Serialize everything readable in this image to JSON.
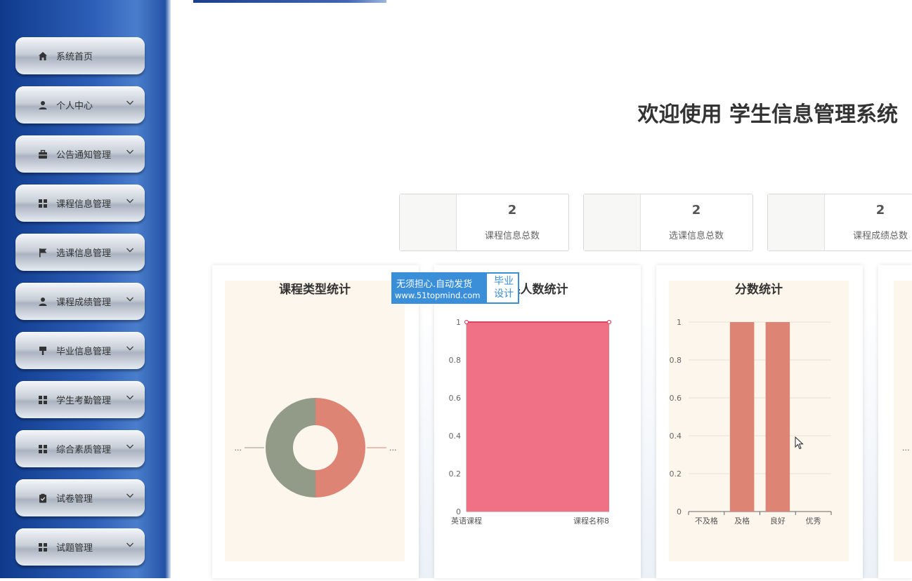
{
  "sidebar": {
    "items": [
      {
        "label": "系统首页",
        "icon": "home-icon",
        "has_children": false
      },
      {
        "label": "个人中心",
        "icon": "user-icon",
        "has_children": true
      },
      {
        "label": "公告通知管理",
        "icon": "briefcase-icon",
        "has_children": true
      },
      {
        "label": "课程信息管理",
        "icon": "grid-icon",
        "has_children": true
      },
      {
        "label": "选课信息管理",
        "icon": "flag-icon",
        "has_children": true
      },
      {
        "label": "课程成绩管理",
        "icon": "user-tie-icon",
        "has_children": true
      },
      {
        "label": "毕业信息管理",
        "icon": "brush-icon",
        "has_children": true
      },
      {
        "label": "学生考勤管理",
        "icon": "grid-icon",
        "has_children": true
      },
      {
        "label": "综合素质管理",
        "icon": "grid-icon",
        "has_children": true
      },
      {
        "label": "试卷管理",
        "icon": "clipboard-check-icon",
        "has_children": true
      },
      {
        "label": "试题管理",
        "icon": "grid-icon",
        "has_children": true
      }
    ]
  },
  "header": {
    "title": "欢迎使用 学生信息管理系统"
  },
  "stats": [
    {
      "value": "2",
      "label": "课程信息总数"
    },
    {
      "value": "2",
      "label": "选课信息总数"
    },
    {
      "value": "2",
      "label": "课程成绩总数"
    }
  ],
  "watermark": {
    "line1": "无须担心.自动发货",
    "line2": "www.51topmind.com",
    "badge_top": "毕业",
    "badge_bottom": "设计"
  },
  "colors": {
    "accent_blue": "#3a8fd8",
    "pie_red": "#dd8475",
    "pie_green": "#929b88",
    "area_red": "#f07185",
    "bar_red": "#dd8475"
  },
  "chart_data": [
    {
      "type": "pie",
      "title": "课程类型统计",
      "donut": true,
      "slices": [
        {
          "name": "...",
          "value": 1,
          "color": "#dd8475"
        },
        {
          "name": "...",
          "value": 1,
          "color": "#929b88"
        }
      ]
    },
    {
      "type": "area",
      "title": "课人数统计",
      "categories": [
        "英语课程",
        "课程名称8"
      ],
      "values": [
        1,
        1
      ],
      "ylim": [
        0,
        1
      ],
      "yticks": [
        "0",
        "0.2",
        "0.4",
        "0.6",
        "0.8",
        "1"
      ],
      "color": "#f07185"
    },
    {
      "type": "bar",
      "title": "分数统计",
      "categories": [
        "不及格",
        "及格",
        "良好",
        "优秀"
      ],
      "values": [
        0,
        1,
        1,
        0
      ],
      "ylim": [
        0,
        1
      ],
      "yticks": [
        "0",
        "0.2",
        "0.4",
        "0.6",
        "0.8",
        "1"
      ],
      "color": "#dd8475"
    },
    {
      "type": "pie",
      "title": "",
      "slices": [
        {
          "name": "..."
        }
      ]
    }
  ]
}
